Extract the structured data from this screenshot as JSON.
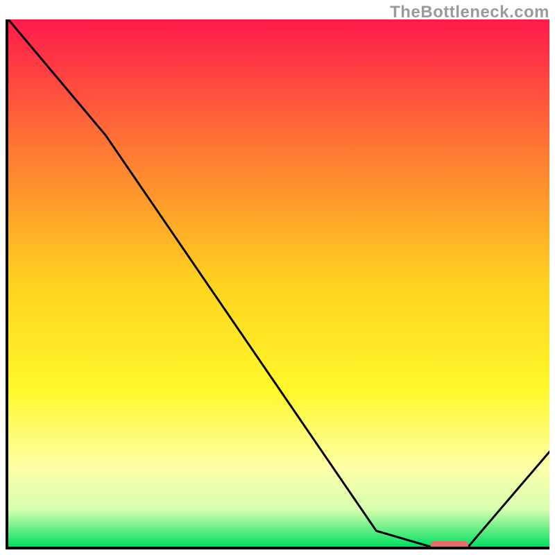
{
  "watermark": "TheBottleneck.com",
  "chart_data": {
    "type": "line",
    "title": "",
    "xlabel": "",
    "ylabel": "",
    "xlim": [
      0,
      100
    ],
    "ylim": [
      0,
      100
    ],
    "x": [
      0,
      18,
      68,
      78,
      85,
      100
    ],
    "values": [
      100,
      78,
      3,
      0,
      0,
      18
    ],
    "optimal_marker": {
      "x_start": 78,
      "x_end": 85,
      "y": 0
    },
    "background_gradient": {
      "stops": [
        {
          "offset": 0.0,
          "color": "#ff1a4b"
        },
        {
          "offset": 0.25,
          "color": "#ff7a33"
        },
        {
          "offset": 0.5,
          "color": "#ffd21f"
        },
        {
          "offset": 0.7,
          "color": "#fff82a"
        },
        {
          "offset": 0.85,
          "color": "#fdffa8"
        },
        {
          "offset": 0.93,
          "color": "#d6ffb0"
        },
        {
          "offset": 1.0,
          "color": "#00e060"
        }
      ]
    }
  }
}
